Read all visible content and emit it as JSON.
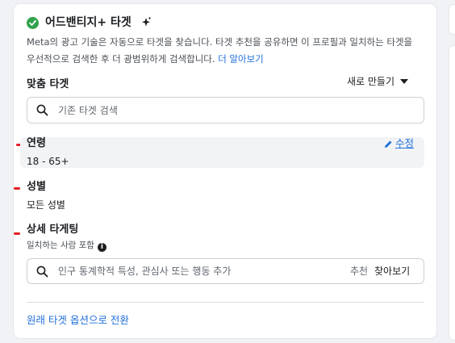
{
  "header": {
    "title": "어드밴티지+ 타겟",
    "description": "Meta의 광고 기술은 자동으로 타겟을 찾습니다. 타겟 추천을 공유하면 이 프로필과 일치하는 타겟을 우선적으로 검색한 후 더 광범위하게 검색합니다.",
    "learn_more": "더 알아보기"
  },
  "custom_audience": {
    "title": "맞춤 타겟",
    "new_button": "새로 만들기",
    "search_placeholder": "기존 타겟 검색"
  },
  "age": {
    "label": "연령",
    "value": "18 - 65+",
    "edit_label": "수정"
  },
  "gender": {
    "label": "성별",
    "value": "모든 성별"
  },
  "detailed_targeting": {
    "label": "상세 타게팅",
    "include_label": "일치하는 사람 포함",
    "search_placeholder": "인구 통계학적 특성, 관심사 또는 행동 추가",
    "suggestions_label": "추천",
    "browse_label": "찾아보기"
  },
  "footer": {
    "switch_link": "원래 타겟 옵션으로 전환"
  },
  "colors": {
    "accent": "#216fdb",
    "success": "#31a24c",
    "marker": "#e41e26"
  },
  "icons": [
    "check-circle-icon",
    "sparkle-icon",
    "search-icon",
    "pencil-icon",
    "info-icon",
    "caret-down-icon"
  ]
}
